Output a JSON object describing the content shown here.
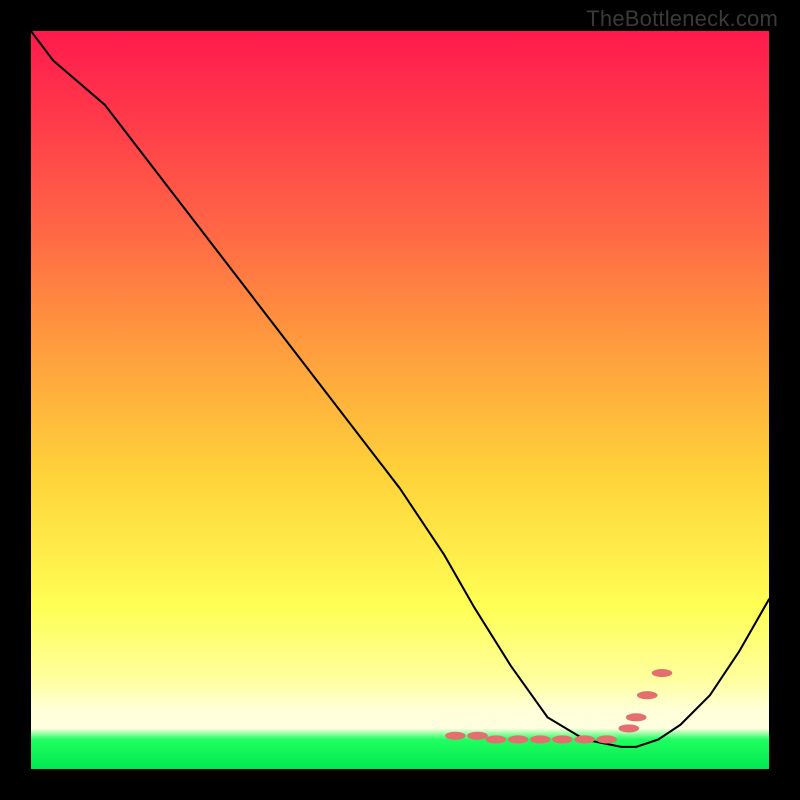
{
  "watermark": "TheBottleneck.com",
  "chart_data": {
    "type": "line",
    "title": "",
    "xlabel": "",
    "ylabel": "",
    "xlim": [
      0,
      100
    ],
    "ylim": [
      0,
      100
    ],
    "series": [
      {
        "name": "curve",
        "x": [
          0,
          3,
          10,
          20,
          30,
          40,
          50,
          56,
          60,
          65,
          70,
          75,
          80,
          82,
          85,
          88,
          92,
          96,
          100
        ],
        "values": [
          100,
          96,
          90,
          77,
          64,
          51,
          38,
          29,
          22,
          14,
          7,
          4,
          3,
          3,
          4,
          6,
          10,
          16,
          23
        ]
      }
    ],
    "markers": {
      "name": "dots",
      "color_rgb": "rgb(229,110,110)",
      "points_x": [
        57.5,
        60.5,
        63,
        66,
        69,
        72,
        75,
        78,
        81,
        82,
        83.5,
        85.5
      ],
      "points_y": [
        4.5,
        4.5,
        4,
        4,
        4,
        4,
        4,
        4,
        5.5,
        7,
        10,
        13
      ]
    },
    "colors": {
      "gradient_top": "#ff1a4d",
      "gradient_mid1": "#ff9a3e",
      "gradient_mid2": "#ffff55",
      "gradient_bottom": "#00e850",
      "line": "#000000",
      "dot": "#e56e6e"
    }
  }
}
